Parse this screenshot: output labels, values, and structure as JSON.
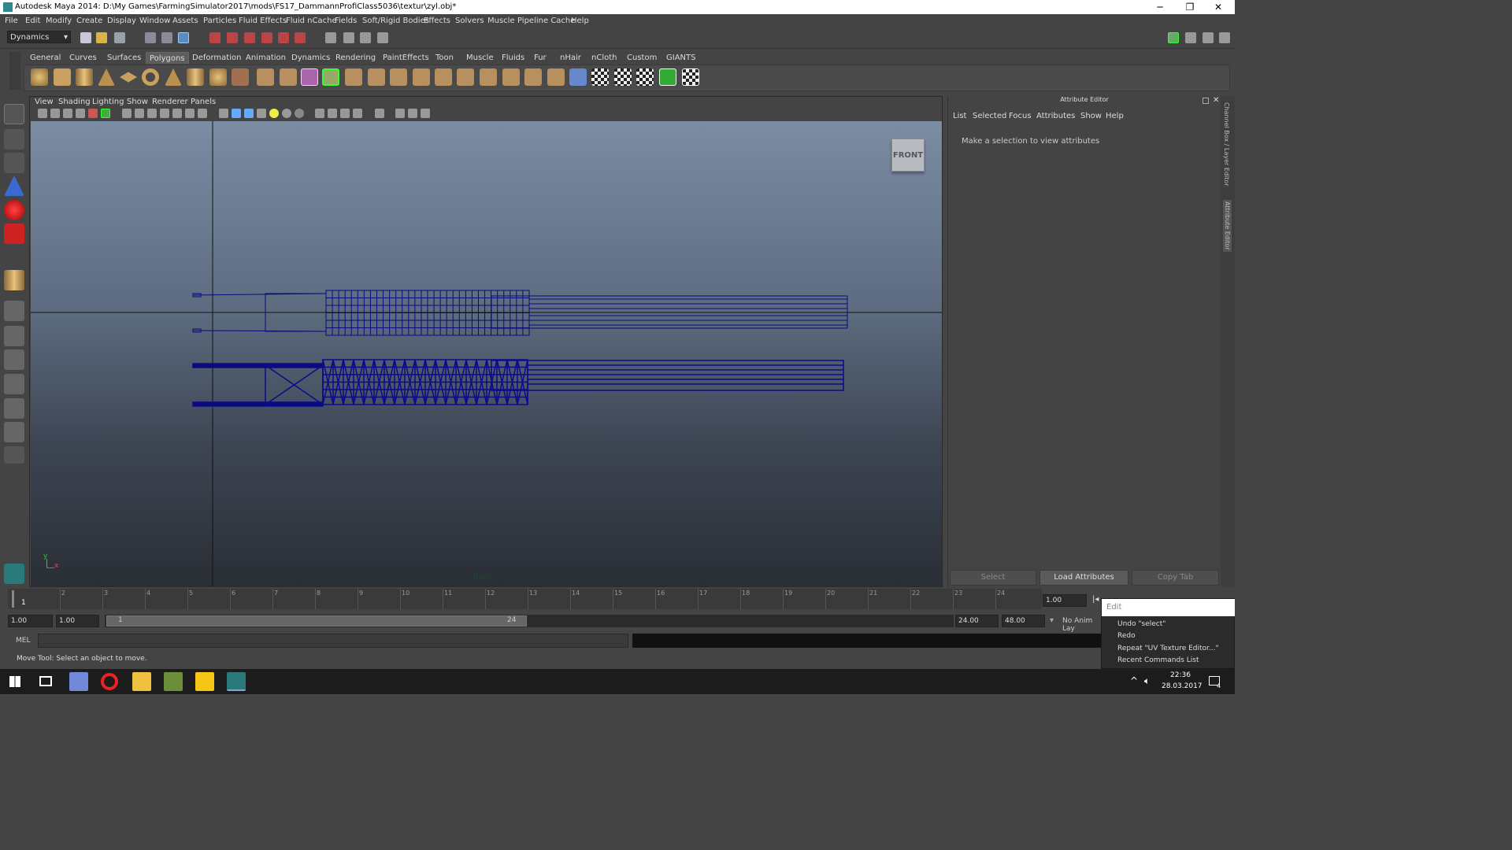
{
  "window": {
    "title": "Autodesk Maya 2014: D:\\My Games\\FarmingSimulator2017\\mods\\FS17_DammannProfiClass5036\\textur\\zyl.obj*",
    "minimize": "─",
    "restore": "❐",
    "close": "✕"
  },
  "menu": [
    "File",
    "Edit",
    "Modify",
    "Create",
    "Display",
    "Window",
    "Assets",
    "Particles",
    "Fluid Effects",
    "Fluid nCache",
    "Fields",
    "Soft/Rigid Bodies",
    "Effects",
    "Solvers",
    "Muscle",
    "Pipeline Cache",
    "Help"
  ],
  "mode_dropdown": "Dynamics",
  "shelf_tabs": [
    "General",
    "Curves",
    "Surfaces",
    "Polygons",
    "Deformation",
    "Animation",
    "Dynamics",
    "Rendering",
    "PaintEffects",
    "Toon",
    "Muscle",
    "Fluids",
    "Fur",
    "nHair",
    "nCloth",
    "Custom",
    "GIANTS"
  ],
  "shelf_active": "Polygons",
  "viewport": {
    "menu": [
      "View",
      "Shading",
      "Lighting",
      "Show",
      "Renderer",
      "Panels"
    ],
    "viewcube_label": "FRONT",
    "camera_label": "front",
    "axis_y": "y",
    "axis_x": "x"
  },
  "attribute_editor": {
    "title": "Attribute Editor",
    "menu": [
      "List",
      "Selected",
      "Focus",
      "Attributes",
      "Show",
      "Help"
    ],
    "message": "Make a selection to view attributes",
    "buttons": {
      "select": "Select",
      "load": "Load Attributes",
      "copy": "Copy Tab"
    }
  },
  "side_tabs": [
    "Channel Box / Layer Editor",
    "Attribute Editor"
  ],
  "timeline": {
    "ticks": [
      "1",
      "2",
      "3",
      "4",
      "5",
      "6",
      "7",
      "8",
      "9",
      "10",
      "11",
      "12",
      "13",
      "14",
      "15",
      "16",
      "17",
      "18",
      "19",
      "20",
      "21",
      "22",
      "23",
      "24"
    ],
    "current_frame": "1.00"
  },
  "range": {
    "start": "1.00",
    "inner_start": "1.00",
    "slider_start": "1",
    "slider_end": "24",
    "end": "24.00",
    "max": "48.00",
    "anim_layer": "No Anim Lay"
  },
  "mel": {
    "label": "MEL"
  },
  "status": "Move Tool: Select an object to move.",
  "popup": {
    "field": "Edit",
    "items": [
      "Undo \"select\"",
      "Redo",
      "Repeat \"UV Texture Editor...\"",
      "Recent Commands List"
    ]
  },
  "taskbar": {
    "time": "22:36",
    "date": "28.03.2017",
    "notif": "4"
  }
}
